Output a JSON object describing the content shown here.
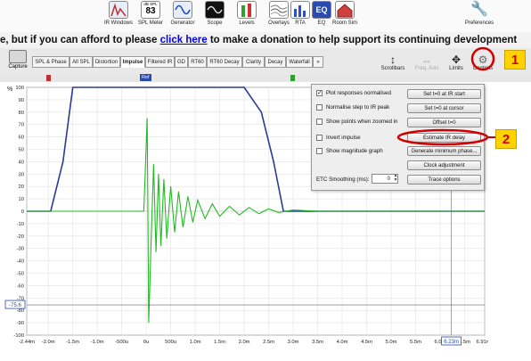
{
  "toolbar": {
    "tools": [
      {
        "label": "IR Windows",
        "icon": "ir-windows-icon"
      },
      {
        "label": "SPL Meter",
        "icon": "spl-meter-icon",
        "meter_unit": "dB SPL",
        "meter_value": "83"
      },
      {
        "label": "Generator",
        "icon": "generator-icon"
      },
      {
        "label": "Scope",
        "icon": "scope-icon"
      },
      {
        "label": "Levels",
        "icon": "levels-icon"
      },
      {
        "label": "Overlays",
        "icon": "overlays-icon"
      },
      {
        "label": "RTA",
        "icon": "rta-icon"
      },
      {
        "label": "EQ",
        "icon": "eq-icon"
      },
      {
        "label": "Room Sim",
        "icon": "room-sim-icon"
      }
    ],
    "preferences_label": "Preferences"
  },
  "banner": {
    "text_before": "e, but if you can afford to please ",
    "link_text": "click here",
    "text_after": " to make a donation to help support its continuing development"
  },
  "tabs": {
    "capture_label": "Capture",
    "items": [
      "SPL & Phase",
      "All SPL",
      "Distortion",
      "Impulse",
      "Filtered IR",
      "GD",
      "RT60",
      "RT60 Decay",
      "Clarity",
      "Decay",
      "Waterfall",
      "»"
    ],
    "active": "Impulse"
  },
  "right_controls": {
    "scrollbars": "Scrollbars",
    "freq_axis": "Freq. Axis",
    "limits": "Limits",
    "controls": "Controls"
  },
  "axis": {
    "y_unit": "%",
    "y_ticks": [
      "100",
      "90",
      "80",
      "70",
      "60",
      "50",
      "40",
      "30",
      "20",
      "10",
      "0",
      "-10",
      "-20",
      "-30",
      "-40",
      "-50",
      "-60",
      "-70",
      "-80",
      "-90",
      "-100"
    ],
    "x_ticks": [
      "-2.44m",
      "-2.0m",
      "-1.5m",
      "-1.0m",
      "-500u",
      "0u",
      "500u",
      "1.0m",
      "1.5m",
      "2.0m",
      "2.5m",
      "3.0m",
      "3.5m",
      "4.0m",
      "4.5m",
      "5.0m",
      "5.5m",
      "6.0m",
      "6.5m",
      "6.91ms"
    ],
    "cursor_y_readout": "-75.6",
    "cursor_x_readout": "6.23m",
    "ref_marker": "Ref"
  },
  "panel": {
    "checkboxes": [
      {
        "label": "Plot responses normalised",
        "checked": true
      },
      {
        "label": "Normalise step to IR peak",
        "checked": false
      },
      {
        "label": "Show points when zoomed in",
        "checked": false
      },
      {
        "label": "Invert impulse",
        "checked": false
      },
      {
        "label": "Show magnitude graph",
        "checked": false
      }
    ],
    "buttons": [
      "Set t=0 at IR start",
      "Set t=0 at cursor",
      "Offset t=0",
      "Estimate IR delay",
      "Generate minimum phase...",
      "Clock adjustment",
      "Trace options"
    ],
    "etc_label": "ETC Smoothing (ms):",
    "etc_value": "0"
  },
  "callouts": [
    "1",
    "2"
  ],
  "colors": {
    "impulse": "#22bb22",
    "step": "#2a3a9a",
    "callout": "#d00000",
    "badge": "#ffd200"
  },
  "chart_data": {
    "type": "line",
    "xlabel": "",
    "ylabel": "%",
    "xlim": [
      -2.44,
      6.91
    ],
    "ylim": [
      -100,
      100
    ],
    "grid": true,
    "series": [
      {
        "points": [
          [
            -2.44,
            0
          ],
          [
            -1.95,
            0
          ],
          [
            -1.7,
            40
          ],
          [
            -1.5,
            100
          ],
          [
            2.0,
            100
          ],
          [
            2.35,
            80
          ],
          [
            2.6,
            40
          ],
          [
            2.8,
            0
          ],
          [
            6.91,
            0
          ]
        ]
      },
      {
        "points": [
          [
            -2.44,
            0
          ],
          [
            -0.05,
            0
          ],
          [
            0.02,
            75
          ],
          [
            0.05,
            -90
          ],
          [
            0.1,
            -25
          ],
          [
            0.15,
            38
          ],
          [
            0.2,
            -33
          ],
          [
            0.25,
            30
          ],
          [
            0.3,
            -28
          ],
          [
            0.36,
            26
          ],
          [
            0.42,
            -22
          ],
          [
            0.5,
            20
          ],
          [
            0.58,
            -17
          ],
          [
            0.66,
            16
          ],
          [
            0.75,
            -13
          ],
          [
            0.85,
            12
          ],
          [
            0.95,
            -9
          ],
          [
            1.05,
            9
          ],
          [
            1.2,
            -6
          ],
          [
            1.35,
            6
          ],
          [
            1.5,
            -4
          ],
          [
            1.7,
            4
          ],
          [
            1.9,
            -3
          ],
          [
            2.1,
            3
          ],
          [
            2.3,
            -2
          ],
          [
            2.5,
            2
          ],
          [
            2.7,
            -1
          ],
          [
            3.0,
            1
          ],
          [
            3.5,
            0
          ],
          [
            6.91,
            0
          ]
        ]
      }
    ]
  }
}
